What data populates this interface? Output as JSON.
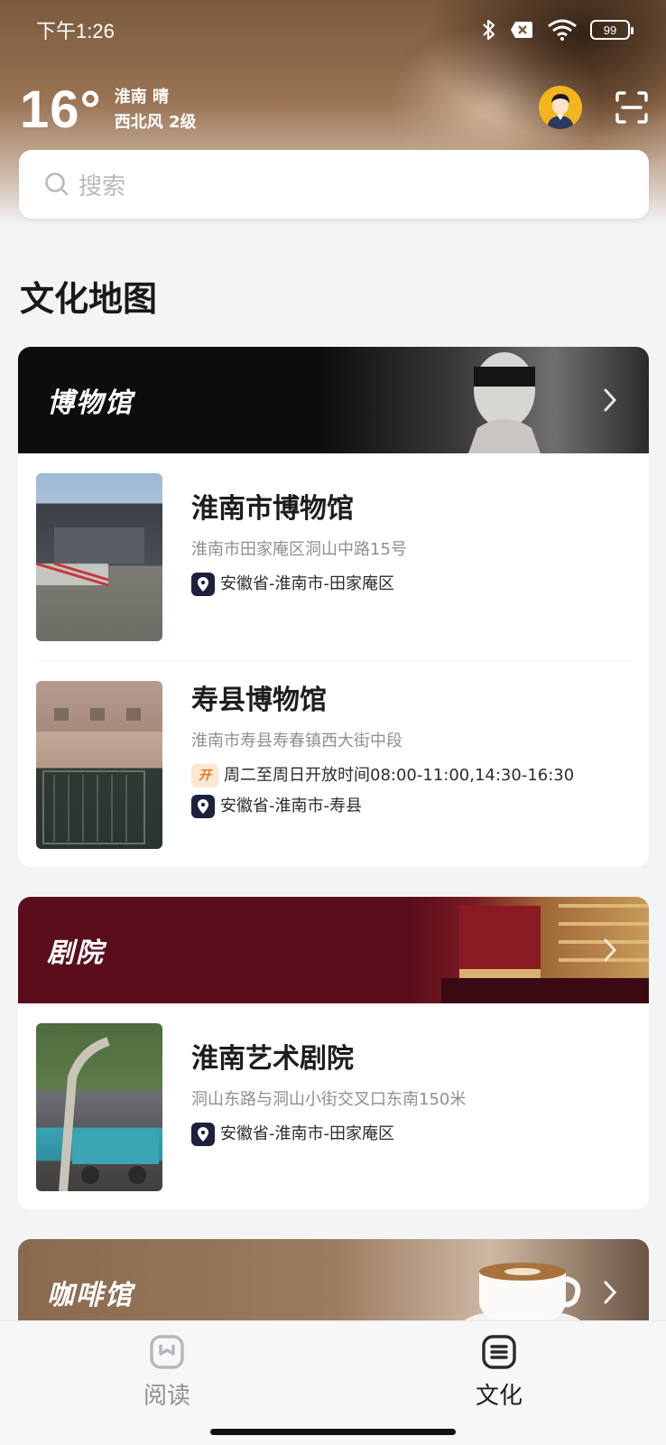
{
  "status_bar": {
    "time": "下午1:26",
    "battery": "99",
    "icons": [
      "bluetooth-icon",
      "no-sim-icon",
      "wifi-icon",
      "battery-icon"
    ]
  },
  "weather": {
    "temperature": "16°",
    "location_condition": "淮南 晴",
    "wind": "西北风 2级"
  },
  "search": {
    "placeholder": "搜索"
  },
  "section": {
    "title": "文化地图"
  },
  "categories": [
    {
      "label": "博物馆",
      "items": [
        {
          "title": "淮南市博物馆",
          "address": "淮南市田家庵区洞山中路15号",
          "hours": "",
          "region": "安徽省-淮南市-田家庵区"
        },
        {
          "title": "寿县博物馆",
          "address": "淮南市寿县寿春镇西大街中段",
          "hours_badge": "开",
          "hours": "周二至周日开放时间08:00-11:00,14:30-16:30",
          "region": "安徽省-淮南市-寿县"
        }
      ]
    },
    {
      "label": "剧院",
      "items": [
        {
          "title": "淮南艺术剧院",
          "address": "洞山东路与洞山小街交叉口东南150米",
          "hours": "",
          "region": "安徽省-淮南市-田家庵区"
        }
      ]
    },
    {
      "label": "咖啡馆",
      "items": []
    }
  ],
  "tabbar": {
    "tabs": [
      {
        "label": "阅读",
        "icon": "book-icon",
        "active": false
      },
      {
        "label": "文化",
        "icon": "culture-list-icon",
        "active": true
      }
    ]
  },
  "colors": {
    "museum_banner": "#0d0d0e",
    "theater_banner": "#5a0e1c",
    "cafe_banner": "#8a6a4e",
    "active_tab": "#1f1f22",
    "inactive_tab": "#8e9096"
  }
}
